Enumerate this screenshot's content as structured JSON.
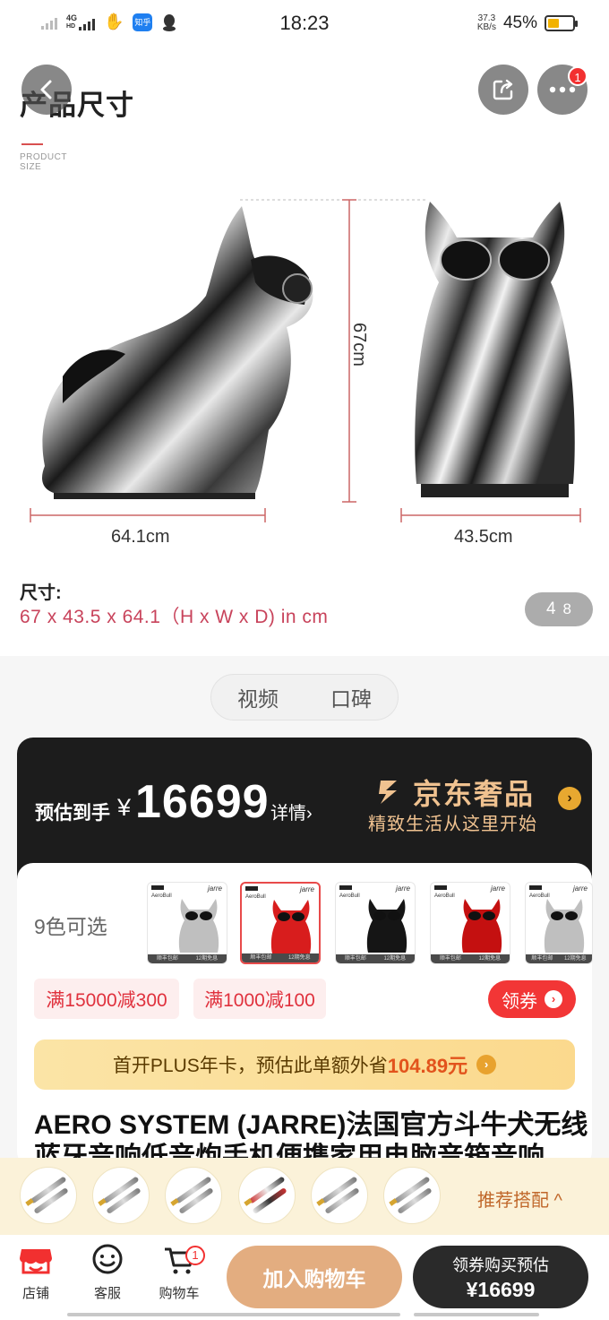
{
  "status_bar": {
    "time": "18:23",
    "network": "4G",
    "network_sub": "HD",
    "net_speed_value": "37.3",
    "net_speed_unit": "KB/s",
    "battery_pct": "45%",
    "battery_level": 0.45,
    "zhihu_icon_text": "知乎"
  },
  "header": {
    "more_badge": "1"
  },
  "dimension_section": {
    "title": "产品尺寸",
    "subtitle_line1": "PRODUCT",
    "subtitle_line2": "SIZE",
    "height_label": "67cm",
    "depth_label": "64.1cm",
    "width_label": "43.5cm",
    "size_heading": "尺寸:",
    "size_value": "67 x 43.5 x 64.1（H x W x D) in cm",
    "pager_current": "4",
    "pager_total": "8"
  },
  "tabs": [
    "视频",
    "口碑"
  ],
  "price_card": {
    "label": "预估到手",
    "currency": "¥",
    "amount": "16699",
    "detail_link": "详情›",
    "brand_name": "京东奢品",
    "slogan": "精致生活从这里开始",
    "arrow": "›"
  },
  "variants": {
    "label": "9色可选",
    "items": [
      {
        "title": "AeroBull",
        "color": "silver",
        "strip_left": "顺丰包邮",
        "strip_right": "12期免息"
      },
      {
        "title": "AeroBull",
        "color": "red",
        "strip_left": "顺丰包邮",
        "strip_right": "12期免息"
      },
      {
        "title": "AeroBull",
        "color": "black",
        "strip_left": "顺丰包邮",
        "strip_right": "12期免息"
      },
      {
        "title": "AeroBull",
        "color": "red-dark",
        "strip_left": "顺丰包邮",
        "strip_right": "12期免息"
      },
      {
        "title": "AeroBull",
        "color": "silver",
        "strip_left": "顺丰包邮",
        "strip_right": "12期免息"
      }
    ],
    "brand": "jarre"
  },
  "coupons": {
    "coupon1": "满15000减300",
    "coupon2": "满1000减100",
    "claim_button": "领券",
    "claim_arrow": "›"
  },
  "plus_bar": {
    "text": "首开PLUS年卡，预估此单额外省",
    "highlight": "104.89元",
    "arrow": "›"
  },
  "product": {
    "title": "AERO SYSTEM (JARRE)法国官方斗牛犬无线蓝牙音响低音炮手机便携家用电脑音箱音响"
  },
  "recommend": {
    "label": "推荐搭配 ^",
    "items_count_shown": 6
  },
  "bottom_bar": {
    "store": "店铺",
    "service": "客服",
    "cart": "购物车",
    "cart_badge": "1",
    "add_to_cart": "加入购物车",
    "buy_line1": "领券购买预估",
    "buy_line2": "¥16699"
  },
  "colors": {
    "accent_red": "#f23030",
    "coupon_text": "#e0313d",
    "gold": "#f0c290",
    "size_value": "#c8435b"
  }
}
